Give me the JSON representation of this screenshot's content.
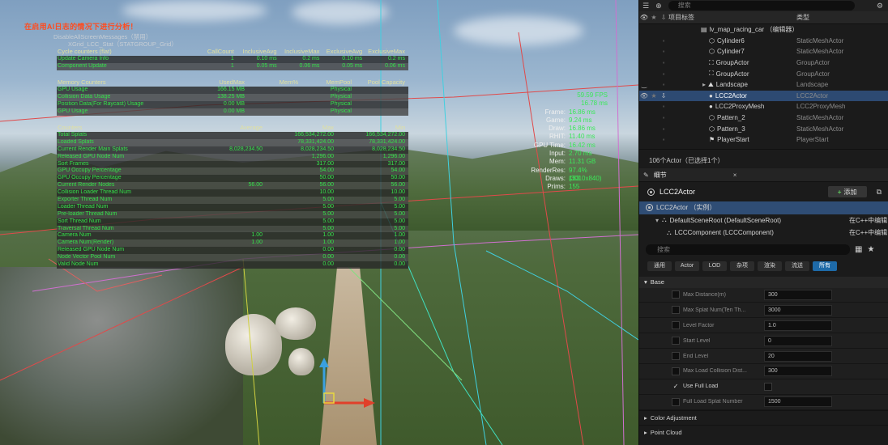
{
  "viewport": {
    "title": "在启用AI日志的情况下进行分析！",
    "subtitle1": "DisableAllScreenMessages（禁用）",
    "subtitle2": "XGrid_LCC_Stat（STATGROUP_Grid）",
    "cycle": {
      "header": [
        "Cycle counters (flat)",
        "CallCount",
        "InclusiveAvg",
        "InclusiveMax",
        "ExclusiveAvg",
        "ExclusiveMax"
      ],
      "rows": [
        [
          "Update Camera Info",
          "1",
          "0.10 ms",
          "0.2 ms",
          "0.10 ms",
          "0.2 ms"
        ],
        [
          "Component Update",
          "1",
          "0.05 ms",
          "0.06 ms",
          "0.05 ms",
          "0.06 ms"
        ]
      ]
    },
    "memory": {
      "header": [
        "Memory Counters",
        "UsedMax",
        "Mem%",
        "MemPool",
        "Pool Capacity"
      ],
      "rows": [
        [
          "GPU Usage",
          "166.15 MB",
          "",
          "Physical",
          ""
        ],
        [
          "Collision Data Usage",
          "138.25 MB",
          "",
          "Physical",
          ""
        ],
        [
          "Position Data(For Raycast) Usage",
          "0.00 MB",
          "",
          "Physical",
          ""
        ],
        [
          "GPU Usage",
          "0.00 MB",
          "",
          "Physical",
          ""
        ]
      ]
    },
    "counters": {
      "header": [
        "Counters",
        "Average",
        "Max",
        "Min"
      ],
      "rows": [
        [
          "Total Splats",
          "",
          "166,534,272.00",
          "166,534,272.00"
        ],
        [
          "Loaded Splats",
          "",
          "78,331,424.00",
          "78,331,424.00"
        ],
        [
          "Current Render Main Splats",
          "8,028,234.50",
          "8,028,234.50",
          "8,028,234.50"
        ],
        [
          "Released GPU Node Num",
          "",
          "1,296.00",
          "1,296.00"
        ],
        [
          "Sort Frames",
          "",
          "317.00",
          "317.00"
        ],
        [
          "GPU Occupy Percentage",
          "",
          "54.00",
          "54.00"
        ],
        [
          "GPU Occupy Percentage",
          "",
          "50.00",
          "50.00"
        ],
        [
          "Current Render Nodes",
          "56.00",
          "56.00",
          "56.00"
        ],
        [
          "Collision Loader Thread Num",
          "",
          "10.00",
          "10.00"
        ],
        [
          "Exporter Thread Num",
          "",
          "5.00",
          "5.00"
        ],
        [
          "Loader Thread Num",
          "",
          "5.00",
          "5.00"
        ],
        [
          "Pre-loader Thread Num",
          "",
          "5.00",
          "5.00"
        ],
        [
          "Sort Thread Num",
          "",
          "5.00",
          "5.00"
        ],
        [
          "Traversal Thread Num",
          "",
          "5.00",
          "5.00"
        ],
        [
          "Camera Num",
          "1.00",
          "1.00",
          "1.00"
        ],
        [
          "Camera Num(Render)",
          "1.00",
          "1.00",
          "1.00"
        ],
        [
          "Released GPU Node Num",
          "",
          "0.00",
          "0.00"
        ],
        [
          "Node Vector Pool Num",
          "",
          "0.00",
          "0.00"
        ],
        [
          "Valid Node Num",
          "",
          "0.00",
          "0.00"
        ]
      ]
    },
    "fps": {
      "fps": "59.59 FPS",
      "ms": "16.78 ms",
      "rows": [
        [
          "Frame:",
          "16.86 ms"
        ],
        [
          "Game:",
          "9.24 ms"
        ],
        [
          "Draw:",
          "16.86 ms"
        ],
        [
          "RHIT:",
          "11.40 ms"
        ],
        [
          "GPU Time:",
          "16.42 ms"
        ],
        [
          "Input:",
          "2.70 ms"
        ],
        [
          "Mem:",
          "11.31 GB"
        ],
        [
          "RenderRes:",
          "97.4% (3010x840)"
        ],
        [
          "Draws:",
          "133"
        ],
        [
          "Prims:",
          "155"
        ]
      ]
    }
  },
  "outliner": {
    "search_placeholder": "搜索",
    "col_label": "项目标签",
    "col_type": "类型",
    "rows": [
      {
        "name": "lv_map_racing_car （编辑器）",
        "type": "",
        "indent": 1,
        "icon": "level",
        "selected": false
      },
      {
        "name": "Cylinder6",
        "type": "StaticMeshActor",
        "indent": 2,
        "icon": "mesh",
        "selected": false
      },
      {
        "name": "Cylinder7",
        "type": "StaticMeshActor",
        "indent": 2,
        "icon": "mesh",
        "selected": false
      },
      {
        "name": "GroupActor",
        "type": "GroupActor",
        "indent": 2,
        "icon": "group",
        "selected": false
      },
      {
        "name": "GroupActor",
        "type": "GroupActor",
        "indent": 2,
        "icon": "group",
        "selected": false
      },
      {
        "name": "Landscape",
        "type": "Landscape",
        "indent": 2,
        "icon": "landscape",
        "selected": false
      },
      {
        "name": "LCC2Actor",
        "type": "LCC2Actor",
        "indent": 2,
        "icon": "actor",
        "selected": true
      },
      {
        "name": "LCC2ProxyMesh",
        "type": "LCC2ProxyMesh",
        "indent": 2,
        "icon": "actor",
        "selected": false
      },
      {
        "name": "Pattern_2",
        "type": "StaticMeshActor",
        "indent": 2,
        "icon": "mesh",
        "selected": false
      },
      {
        "name": "Pattern_3",
        "type": "StaticMeshActor",
        "indent": 2,
        "icon": "mesh",
        "selected": false
      },
      {
        "name": "PlayerStart",
        "type": "PlayerStart",
        "indent": 2,
        "icon": "player",
        "selected": false
      }
    ],
    "footer": "106个Actor（已选择1个）"
  },
  "details": {
    "tab": "细节",
    "actor": "LCC2Actor",
    "add_label": "添加",
    "instance": "LCC2Actor （实例）",
    "tree": [
      {
        "name": "DefaultSceneRoot (DefaultSceneRoot)",
        "right": "在C++中编辑"
      },
      {
        "name": "LCCComponent (LCCComponent)",
        "right": "在C++中编辑"
      }
    ],
    "search_placeholder": "搜索",
    "categories": [
      "通用",
      "Actor",
      "LOD",
      "杂项",
      "渲染",
      "流送",
      "所有"
    ],
    "active_category": 6,
    "section": "Base",
    "props": [
      {
        "label": "Max Distance(m)",
        "value": "300",
        "checked": false
      },
      {
        "label": "Max Splat Num(Ten Th...",
        "value": "3000",
        "checked": false
      },
      {
        "label": "Level Factor",
        "value": "1.0",
        "checked": false
      },
      {
        "label": "Start Level",
        "value": "0",
        "checked": false
      },
      {
        "label": "End Level",
        "value": "20",
        "checked": false
      },
      {
        "label": "Max Load Collision Dist...",
        "value": "300",
        "checked": false
      },
      {
        "label": "Use Full Load",
        "value": "",
        "checked": true,
        "bool": true
      },
      {
        "label": "Full Load Splat Number",
        "value": "1500",
        "checked": false
      }
    ],
    "collapsed_sections": [
      "Color Adjustment",
      "Point Cloud"
    ]
  },
  "colors": {
    "stat_green": "#35e04a",
    "title_red": "#ff4b1e",
    "selection_blue": "#2d4a72",
    "category_active": "#1e6aa8"
  }
}
